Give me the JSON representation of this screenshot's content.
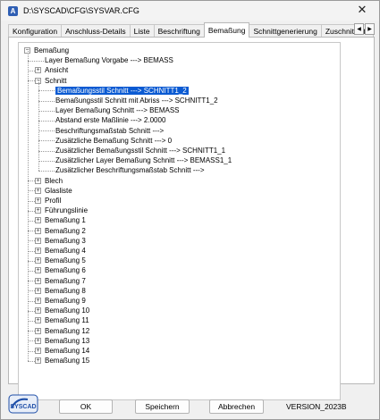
{
  "window": {
    "title": "D:\\SYSCAD\\CFG\\SYSVAR.CFG",
    "app_icon_letter": "A",
    "close_glyph": "✕"
  },
  "tabs": [
    {
      "label": "Konfiguration"
    },
    {
      "label": "Anschluss-Details"
    },
    {
      "label": "Liste"
    },
    {
      "label": "Beschriftung"
    },
    {
      "label": "Bemaßung",
      "active": true
    },
    {
      "label": "Schnittgenerierung"
    },
    {
      "label": "Zuschnittliste"
    }
  ],
  "tab_scroll": {
    "left": "◀",
    "right": "▶"
  },
  "tree": {
    "root": {
      "label": "Bemaßung",
      "expander": "−"
    },
    "items": [
      {
        "label": "Layer Bemaßung Vorgabe  --->  BEMASS",
        "level": 1,
        "expander": ""
      },
      {
        "label": "Ansicht",
        "level": 1,
        "expander": "+"
      },
      {
        "label": "Schnitt",
        "level": 1,
        "expander": "−"
      },
      {
        "label": "Bemaßungsstil Schnitt  --->  SCHNITT1_2",
        "level": 2,
        "expander": "",
        "selected": true
      },
      {
        "label": "Bemaßungsstil Schnitt mit Abriss  --->  SCHNITT1_2",
        "level": 2,
        "expander": ""
      },
      {
        "label": "Layer Bemaßung Schnitt  --->  BEMASS",
        "level": 2,
        "expander": ""
      },
      {
        "label": "Abstand erste Maßlinie  --->  2.0000",
        "level": 2,
        "expander": ""
      },
      {
        "label": "Beschriftungsmaßstab Schnitt  --->",
        "level": 2,
        "expander": ""
      },
      {
        "label": "Zusätzliche Bemaßung Schnitt  --->  0",
        "level": 2,
        "expander": ""
      },
      {
        "label": "Zusätzlicher Bemaßungsstil Schnitt  --->  SCHNITT1_1",
        "level": 2,
        "expander": ""
      },
      {
        "label": "Zusätzlicher Layer Bemaßung Schnitt  --->  BEMASS1_1",
        "level": 2,
        "expander": ""
      },
      {
        "label": "Zusätzlicher Beschriftungsmaßstab Schnitt  --->",
        "level": 2,
        "expander": ""
      },
      {
        "label": "Blech",
        "level": 1,
        "expander": "+"
      },
      {
        "label": "Glasliste",
        "level": 1,
        "expander": "+"
      },
      {
        "label": "Profil",
        "level": 1,
        "expander": "+"
      },
      {
        "label": "Führungslinie",
        "level": 1,
        "expander": "+"
      },
      {
        "label": "Bemaßung 1",
        "level": 1,
        "expander": "+"
      },
      {
        "label": "Bemaßung 2",
        "level": 1,
        "expander": "+"
      },
      {
        "label": "Bemaßung 3",
        "level": 1,
        "expander": "+"
      },
      {
        "label": "Bemaßung 4",
        "level": 1,
        "expander": "+"
      },
      {
        "label": "Bemaßung 5",
        "level": 1,
        "expander": "+"
      },
      {
        "label": "Bemaßung 6",
        "level": 1,
        "expander": "+"
      },
      {
        "label": "Bemaßung 7",
        "level": 1,
        "expander": "+"
      },
      {
        "label": "Bemaßung 8",
        "level": 1,
        "expander": "+"
      },
      {
        "label": "Bemaßung 9",
        "level": 1,
        "expander": "+"
      },
      {
        "label": "Bemaßung 10",
        "level": 1,
        "expander": "+"
      },
      {
        "label": "Bemaßung 11",
        "level": 1,
        "expander": "+"
      },
      {
        "label": "Bemaßung 12",
        "level": 1,
        "expander": "+"
      },
      {
        "label": "Bemaßung 13",
        "level": 1,
        "expander": "+"
      },
      {
        "label": "Bemaßung 14",
        "level": 1,
        "expander": "+"
      },
      {
        "label": "Bemaßung 15",
        "level": 1,
        "expander": "+"
      }
    ]
  },
  "logo": {
    "text": "SYSCAD",
    "icon": "syscad-logo"
  },
  "buttons": {
    "ok": "OK",
    "save": "Speichern",
    "cancel": "Abbrechen"
  },
  "version": "VERSION_2023B",
  "colors": {
    "selection": "#0a5ad2",
    "logo_blue": "#1f4fa8"
  }
}
